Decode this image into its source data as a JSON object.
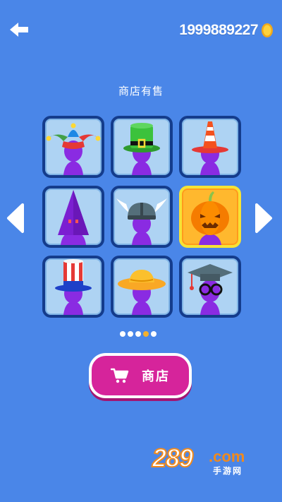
{
  "header": {
    "coin_count": "1999889227",
    "back_icon": "back-arrow-icon",
    "coin_icon": "gold-coin-icon"
  },
  "title": "商店有售",
  "hats": [
    {
      "name": "jester-hat",
      "selected": false
    },
    {
      "name": "green-top-hat",
      "selected": false
    },
    {
      "name": "traffic-cone-hat",
      "selected": false
    },
    {
      "name": "purple-hood-hat",
      "selected": false
    },
    {
      "name": "viking-winged-helmet",
      "selected": false
    },
    {
      "name": "pumpkin-head",
      "selected": true
    },
    {
      "name": "stars-stripes-top-hat",
      "selected": false
    },
    {
      "name": "straw-sun-hat",
      "selected": false
    },
    {
      "name": "graduation-cap-glasses",
      "selected": false
    }
  ],
  "pagination": {
    "total_pages": 5,
    "current_page": 4
  },
  "shop_button": {
    "label": "商店",
    "icon": "cart-icon"
  },
  "watermark": {
    "number": "289",
    "domain": ".com",
    "subtitle": "手游网"
  },
  "colors": {
    "background": "#4a86e8",
    "card": "#aed3f3",
    "card_border": "#143c8c",
    "selected": "#ffb82e",
    "shop_button": "#d6249b",
    "character": "#8a2be2"
  }
}
